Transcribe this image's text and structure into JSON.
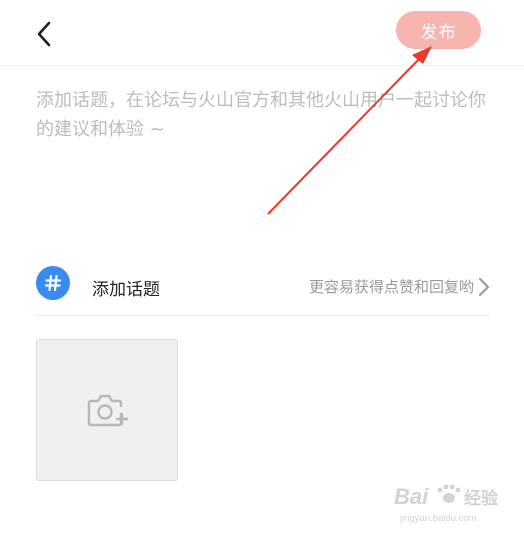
{
  "header": {
    "back_icon": "chevron-left-icon",
    "publish_label": "发布",
    "publish_color": "#f8b4ae"
  },
  "composer": {
    "placeholder": "添加话题，在论坛与火山官方和其他火山用户一起讨论你的建议和体验 ~"
  },
  "topic": {
    "icon": "hashtag-icon",
    "icon_color": "#3a8bf0",
    "label": "添加话题",
    "hint": "更容易获得点赞和回复哟",
    "chevron_icon": "chevron-right-icon"
  },
  "media": {
    "add_photo_icon": "camera-plus-icon"
  },
  "annotation": {
    "arrow_color": "#e83a2e"
  },
  "watermark": {
    "brand": "Baidu经验",
    "site": "jingyan.baidu.com"
  }
}
